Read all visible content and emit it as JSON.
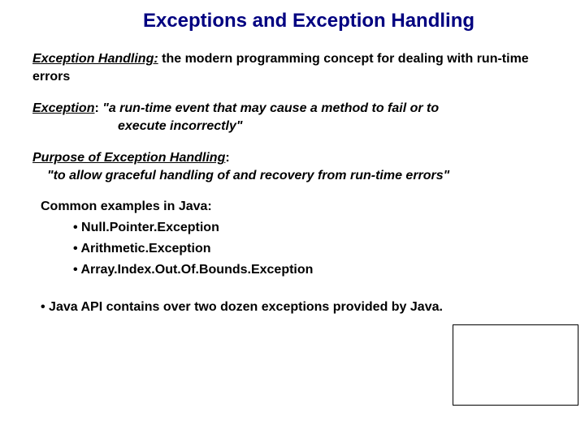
{
  "title": "Exceptions and Exception Handling",
  "section1": {
    "term": "Exception Handling:",
    "def": "  the modern programming concept for dealing with run-time errors"
  },
  "section2": {
    "term": "Exception",
    "colon": ":  ",
    "def1": "\"a run-time event that may cause a method to fail or to",
    "def2": "execute incorrectly\""
  },
  "section3": {
    "term": "Purpose of Exception Handling",
    "colon": ":",
    "def": "\"to allow graceful handling of and recovery from run-time errors\""
  },
  "examples": {
    "header": "Common examples in Java:",
    "items": [
      "Null.Pointer.Exception",
      "Arithmetic.Exception",
      "Array.Index.Out.Of.Bounds.Exception"
    ]
  },
  "footer": "• Java API contains over two dozen exceptions provided by Java."
}
